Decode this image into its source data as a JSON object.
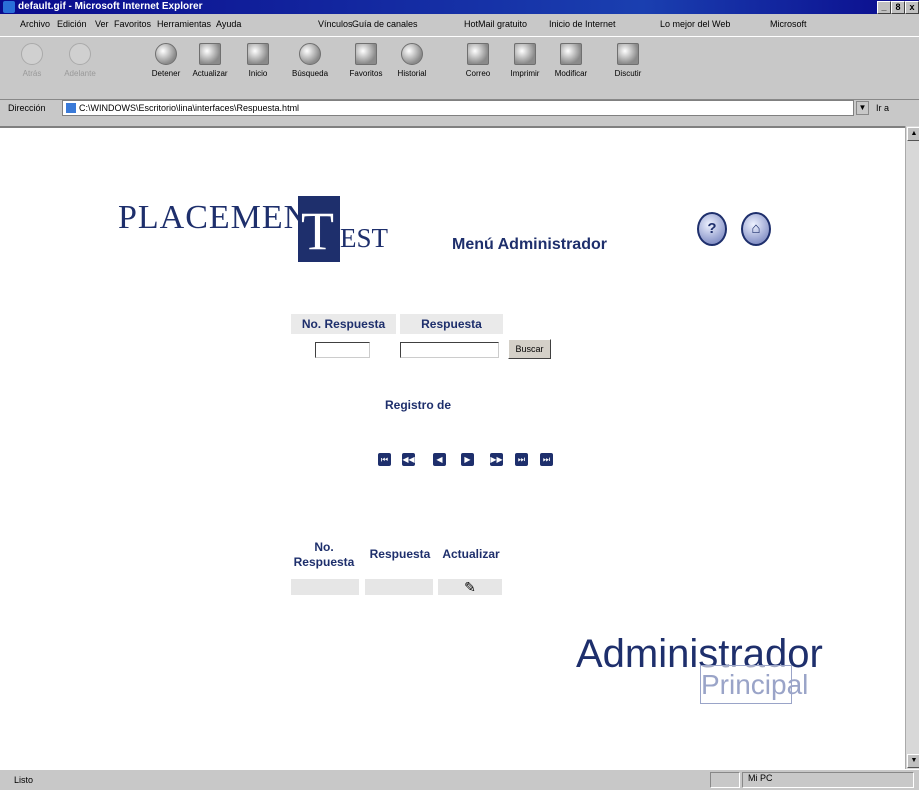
{
  "window": {
    "title": "default.gif - Microsoft Internet Explorer",
    "min": "_",
    "max": "8",
    "close": "x"
  },
  "menubar": {
    "items": [
      "Archivo",
      "Edición",
      "Ver",
      "Favoritos",
      "Herramientas",
      "Ayuda"
    ],
    "links_label": "Vínculos",
    "links": [
      "Guía de canales",
      "HotMail gratuito",
      "Inicio de Internet",
      "Lo mejor del Web",
      "Microsoft"
    ]
  },
  "toolbar": {
    "buttons": [
      "Atrás",
      "Adelante",
      "Detener",
      "Actualizar",
      "Inicio",
      "Búsqueda",
      "Favoritos",
      "Historial",
      "Correo",
      "Imprimir",
      "Modificar",
      "Discutir"
    ]
  },
  "address": {
    "label": "Dirección",
    "value": "C:\\WINDOWS\\Escritorio\\lina\\interfaces\\Respuesta.html",
    "go": "Ir a"
  },
  "page": {
    "logo": {
      "left": "PLACEMEN",
      "t": "T",
      "right": "EST"
    },
    "menu_title": "Menú Administrador",
    "help_icon": "?",
    "home_icon": "⌂",
    "search": {
      "col1": "No. Respuesta",
      "col2": "Respuesta",
      "button": "Buscar",
      "value1": "",
      "value2": ""
    },
    "registro": "Registro de",
    "nav": [
      "⏮",
      "◀◀",
      "◀",
      "▶",
      "▶▶",
      "⏭",
      "⏭"
    ],
    "results": {
      "col1": "No.\nRespuesta",
      "col2": "Respuesta",
      "col3": "Actualizar",
      "edit_icon": "✎"
    },
    "admin": {
      "title": "Administrador",
      "subtitle": "Principal"
    }
  },
  "status": {
    "text": "Listo",
    "zone": "Mi PC"
  }
}
